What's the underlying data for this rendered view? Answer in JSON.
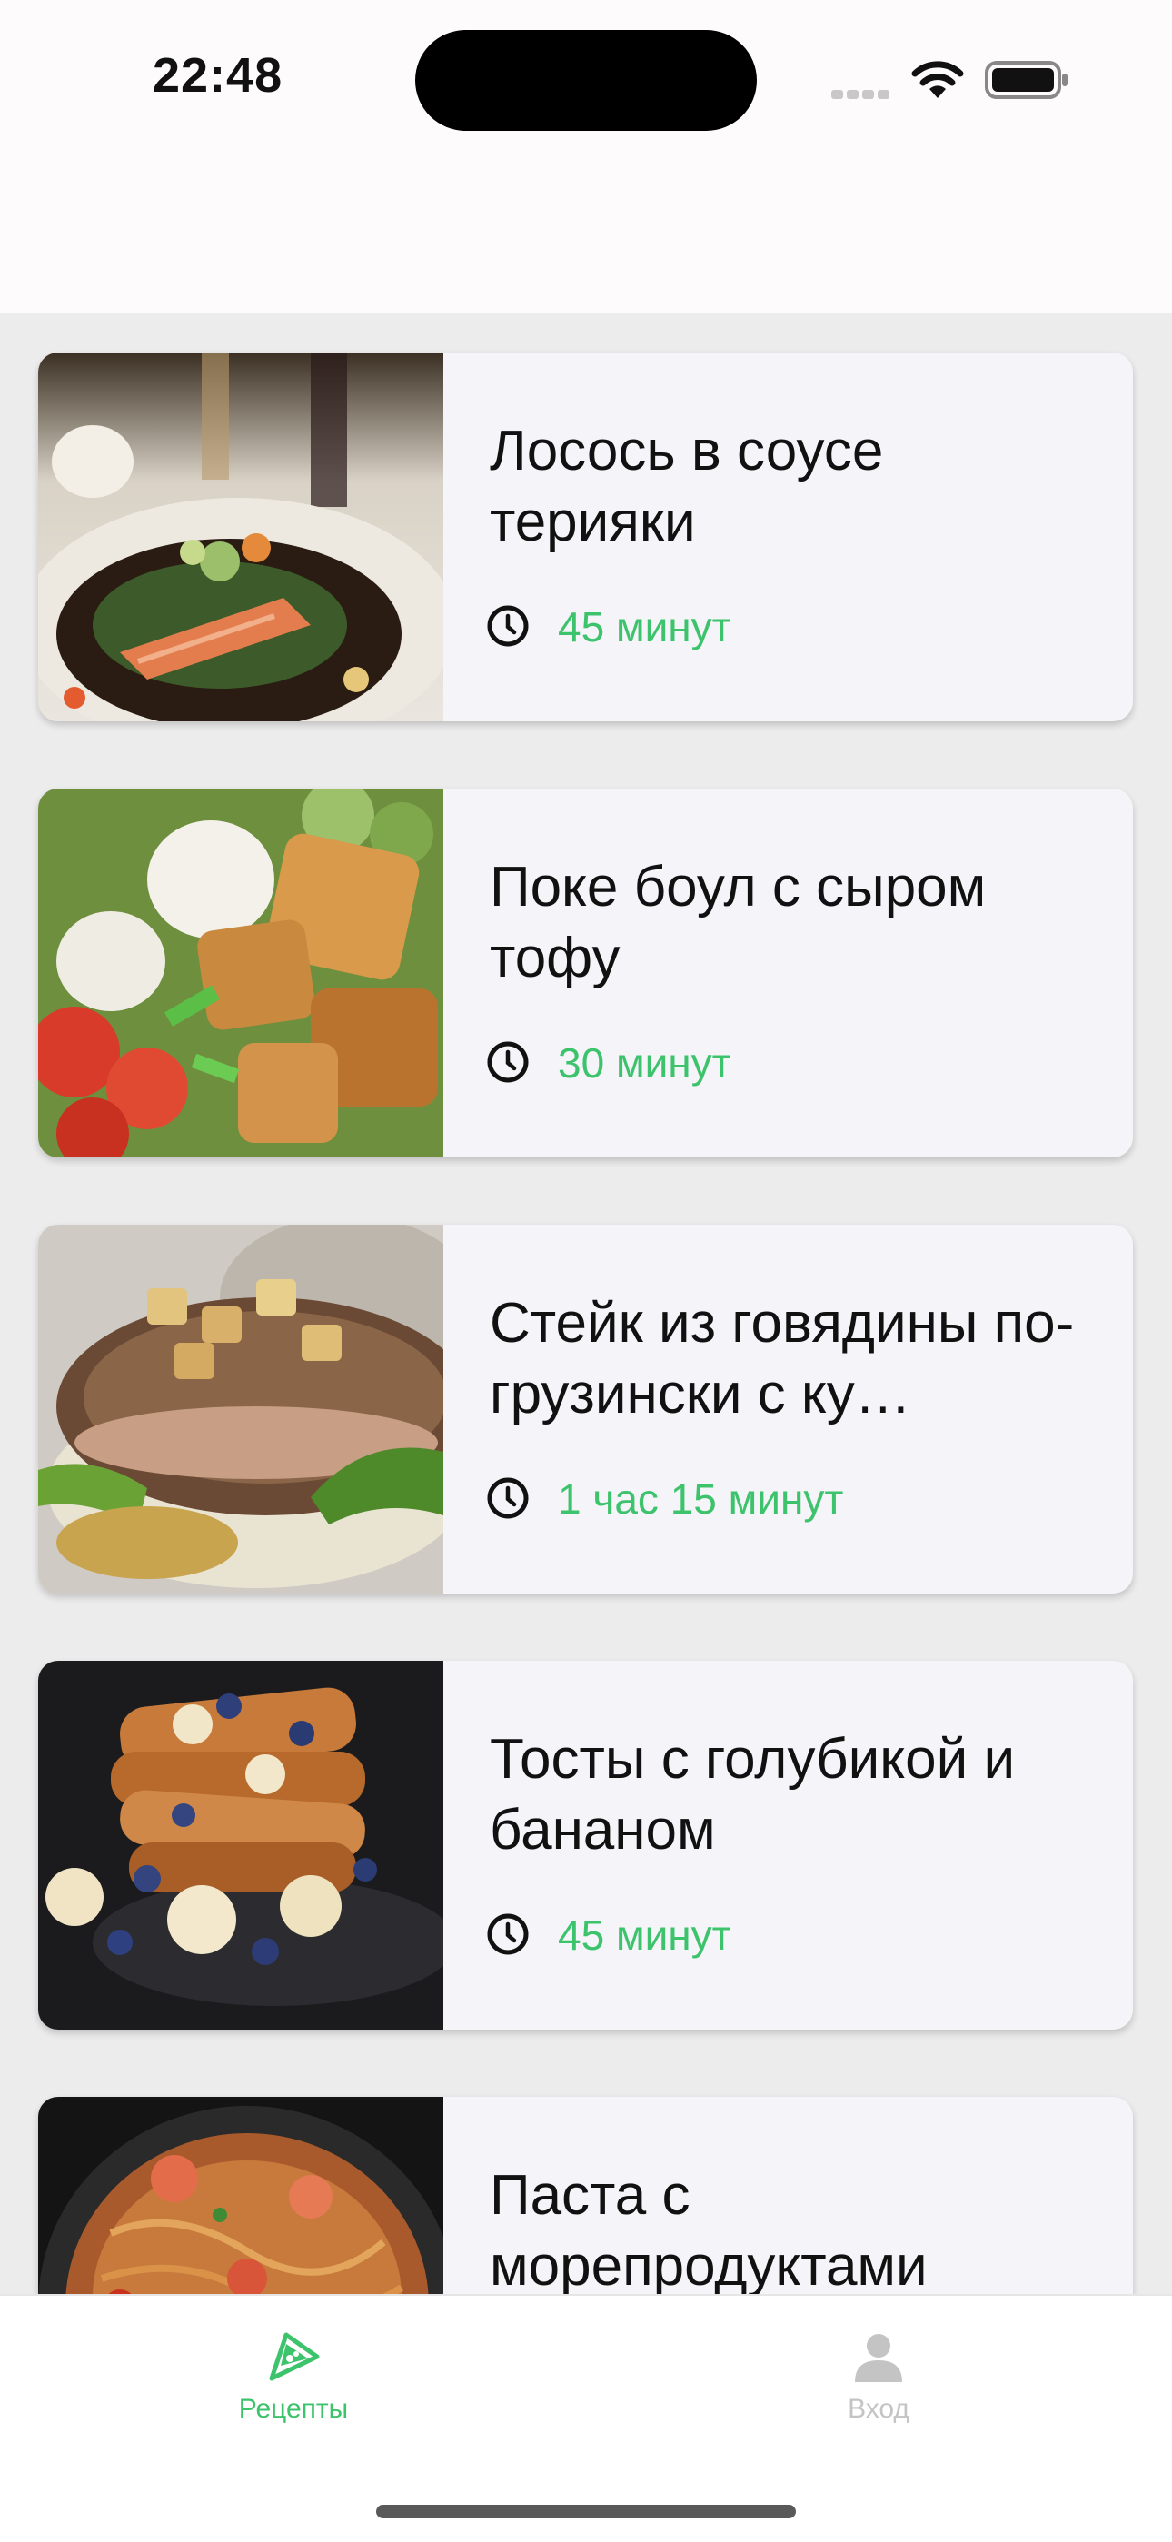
{
  "status_bar": {
    "time": "22:48"
  },
  "recipes": [
    {
      "title": "Лосось в соусе терияки",
      "duration": "45 минут",
      "image": "salmon-teriyaki-photo"
    },
    {
      "title": "Поке боул с сыром тофу",
      "duration": "30 минут",
      "image": "poke-bowl-tofu-photo"
    },
    {
      "title": "Стейк из говядины по-грузински с ку…",
      "duration": "1 час 15 минут",
      "image": "beef-steak-photo"
    },
    {
      "title": "Тосты с голубикой и бананом",
      "duration": "45 минут",
      "image": "blueberry-banana-toast-photo"
    },
    {
      "title": "Паста с морепродуктами",
      "duration": "",
      "image": "seafood-pasta-photo"
    }
  ],
  "tab_bar": {
    "tabs": [
      {
        "label": "Рецепты",
        "icon": "pizza-slice-icon",
        "active": true
      },
      {
        "label": "Вход",
        "icon": "person-icon",
        "active": false
      }
    ]
  },
  "colors": {
    "accent": "#3ec36d",
    "inactive": "#c4c4c4",
    "card_bg": "#f4f4f9",
    "list_bg": "#ececec"
  }
}
